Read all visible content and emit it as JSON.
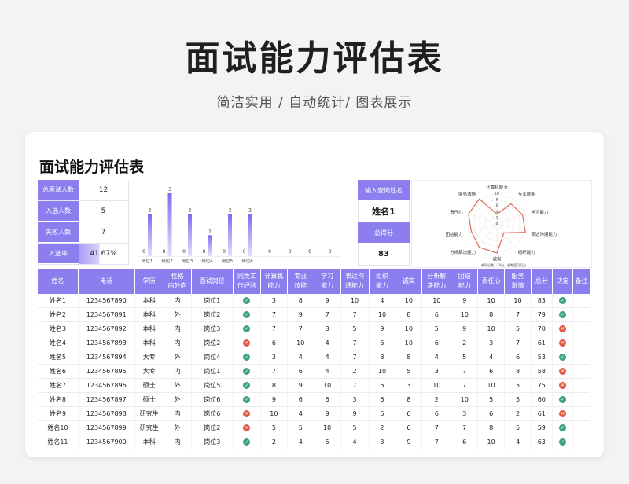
{
  "hero": {
    "title": "面试能力评估表",
    "subtitle": "简洁实用 / 自动统计/ 图表展示"
  },
  "sheet": {
    "title": "面试能力评估表"
  },
  "stats": [
    {
      "label": "总面试人数",
      "value": "12"
    },
    {
      "label": "入选人数",
      "value": "5"
    },
    {
      "label": "失败人数",
      "value": "7"
    },
    {
      "label": "入选率",
      "value": "41.67%",
      "fill": 0.4167
    }
  ],
  "chart_data": {
    "type": "bar",
    "categories": [
      "岗位1",
      "岗位2",
      "岗位3",
      "岗位4",
      "岗位5",
      "岗位6",
      "",
      "",
      "",
      ""
    ],
    "series": [
      {
        "values": [
          2,
          3,
          2,
          1,
          2,
          2,
          0,
          0,
          0,
          0
        ]
      }
    ],
    "sub_values": [
      0,
      0,
      0,
      0,
      0,
      0
    ],
    "ylim": [
      0,
      3
    ]
  },
  "query": {
    "name_label": "输入查询姓名",
    "name_value": "姓名1",
    "score_label": "总得分",
    "score_value": "83"
  },
  "radar": {
    "axes": [
      "计算机能力",
      "专业技能",
      "学习能力",
      "表达沟通能力",
      "组织能力",
      "诚实",
      "分析解决能力",
      "团结能力",
      "责任心",
      "服务激情"
    ],
    "values": [
      3,
      8,
      9,
      10,
      4,
      10,
      10,
      9,
      10,
      10
    ],
    "max": 10,
    "ticks": [
      "0",
      "2",
      "4",
      "6",
      "8",
      "10"
    ],
    "note": "单项分数1-10分，横断值可打分",
    "line_color": "#e06b5c"
  },
  "table": {
    "headers": [
      "姓名",
      "电话",
      "学历",
      "性格\n内外向",
      "面试岗位",
      "同类工\n作经验",
      "计算机\n能力",
      "专业\n技能",
      "学习\n能力",
      "表达沟\n通能力",
      "组织\n能力",
      "诚实",
      "分析解\n决能力",
      "团结\n能力",
      "责任心",
      "服务\n激情",
      "总分",
      "决定",
      "备注"
    ],
    "rows": [
      [
        "姓名1",
        "1234567890",
        "本科",
        "内",
        "岗位1",
        "ok",
        "3",
        "8",
        "9",
        "10",
        "4",
        "10",
        "10",
        "9",
        "10",
        "10",
        "83",
        "ok",
        ""
      ],
      [
        "姓名2",
        "1234567891",
        "本科",
        "外",
        "岗位2",
        "ok",
        "7",
        "9",
        "7",
        "7",
        "10",
        "8",
        "6",
        "10",
        "8",
        "7",
        "79",
        "ok",
        ""
      ],
      [
        "姓名3",
        "1234567892",
        "本科",
        "内",
        "岗位3",
        "ok",
        "7",
        "7",
        "3",
        "5",
        "9",
        "10",
        "5",
        "9",
        "10",
        "5",
        "70",
        "no",
        ""
      ],
      [
        "姓名4",
        "1234567893",
        "本科",
        "内",
        "岗位2",
        "no",
        "6",
        "10",
        "4",
        "7",
        "6",
        "10",
        "6",
        "2",
        "3",
        "7",
        "61",
        "no",
        ""
      ],
      [
        "姓名5",
        "1234567894",
        "大专",
        "外",
        "岗位4",
        "ok",
        "3",
        "4",
        "4",
        "7",
        "8",
        "8",
        "4",
        "5",
        "4",
        "6",
        "53",
        "ok",
        ""
      ],
      [
        "姓名6",
        "1234567895",
        "大专",
        "内",
        "岗位1",
        "ok",
        "7",
        "6",
        "4",
        "2",
        "10",
        "5",
        "3",
        "7",
        "6",
        "8",
        "58",
        "no",
        ""
      ],
      [
        "姓名7",
        "1234567896",
        "硕士",
        "外",
        "岗位5",
        "ok",
        "8",
        "9",
        "10",
        "7",
        "6",
        "3",
        "10",
        "7",
        "10",
        "5",
        "75",
        "no",
        ""
      ],
      [
        "姓名8",
        "1234567897",
        "硕士",
        "外",
        "岗位6",
        "ok",
        "9",
        "6",
        "6",
        "3",
        "6",
        "8",
        "2",
        "10",
        "5",
        "5",
        "60",
        "ok",
        ""
      ],
      [
        "姓名9",
        "1234567898",
        "研究生",
        "内",
        "岗位6",
        "no",
        "10",
        "4",
        "9",
        "9",
        "6",
        "6",
        "6",
        "3",
        "6",
        "2",
        "61",
        "no",
        ""
      ],
      [
        "姓名10",
        "1234567899",
        "研究生",
        "外",
        "岗位2",
        "no",
        "5",
        "5",
        "10",
        "5",
        "2",
        "6",
        "7",
        "7",
        "8",
        "5",
        "59",
        "ok",
        ""
      ],
      [
        "姓名11",
        "1234567900",
        "本科",
        "内",
        "岗位3",
        "ok",
        "2",
        "4",
        "5",
        "4",
        "3",
        "9",
        "7",
        "6",
        "10",
        "4",
        "63",
        "ok",
        ""
      ]
    ]
  }
}
